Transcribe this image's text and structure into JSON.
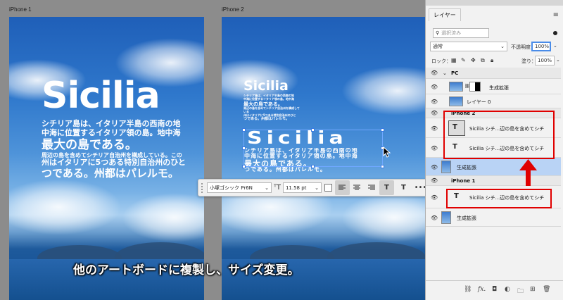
{
  "artboards": {
    "left_label": "iPhone 1",
    "right_label": "iPhone 2",
    "left": {
      "title": "Sicilia",
      "lines": [
        "シチリア島は、イタリア半島の西南の地",
        "中海に位置するイタリア領の島。地中海",
        "最大の島である。",
        "周辺の島を含めてシチリア自治州を構成している。この",
        "州はイタリアに5つある特別自治州のひと",
        "つである。州都はパレルモ。"
      ]
    },
    "right": {
      "title_small": "Sicilia",
      "small_lines": [
        "シチリア島は、イタリア半島の西南の地",
        "中海に位置するイタリア領の島。地中海",
        "最大の島である。",
        "周辺の島を含めてシチリア自治州を構成している",
        "州はイタリアに5つある特別自治州のひと",
        "つである。州都はパレルモ。"
      ],
      "title_selected": "Sicilia",
      "selected_lines": [
        "シチリア島は、イタリア半島の西南の地",
        "中海に位置するイタリア領の島。地中海",
        "最大の島である。",
        "つである。州都はパレルモ。"
      ]
    }
  },
  "caption": "他のアートボードに複製し、サイズ変更。",
  "taskbar": {
    "font": "小塚ゴシック Pr6N",
    "size": "11.58 pt"
  },
  "panel": {
    "tab": "レイヤー",
    "search_placeholder": "選択済み",
    "blend_mode": "通常",
    "opacity_label": "不透明度：",
    "opacity_value": "100%",
    "lock_label": "ロック：",
    "fill_label": "塗り：",
    "fill_value": "100%",
    "layers": [
      {
        "type": "group",
        "name": "PC"
      },
      {
        "type": "image",
        "name": "生成拡張"
      },
      {
        "type": "image",
        "name": "レイヤー 0"
      },
      {
        "type": "group",
        "name": "iPhone 2"
      },
      {
        "type": "text",
        "name": "Sicilia シチ...辺の島を含めてシチ"
      },
      {
        "type": "text",
        "name": "Sicilia シチ...辺の島を含めてシチ"
      },
      {
        "type": "image",
        "name": "生成拡張"
      },
      {
        "type": "group",
        "name": "iPhone 1"
      },
      {
        "type": "text",
        "name": "Sicilia シチ...辺の島を含めてシチ"
      },
      {
        "type": "image",
        "name": "生成拡張"
      }
    ]
  },
  "colors": {
    "highlight": "#e00000",
    "selection": "#b9d3f5"
  }
}
